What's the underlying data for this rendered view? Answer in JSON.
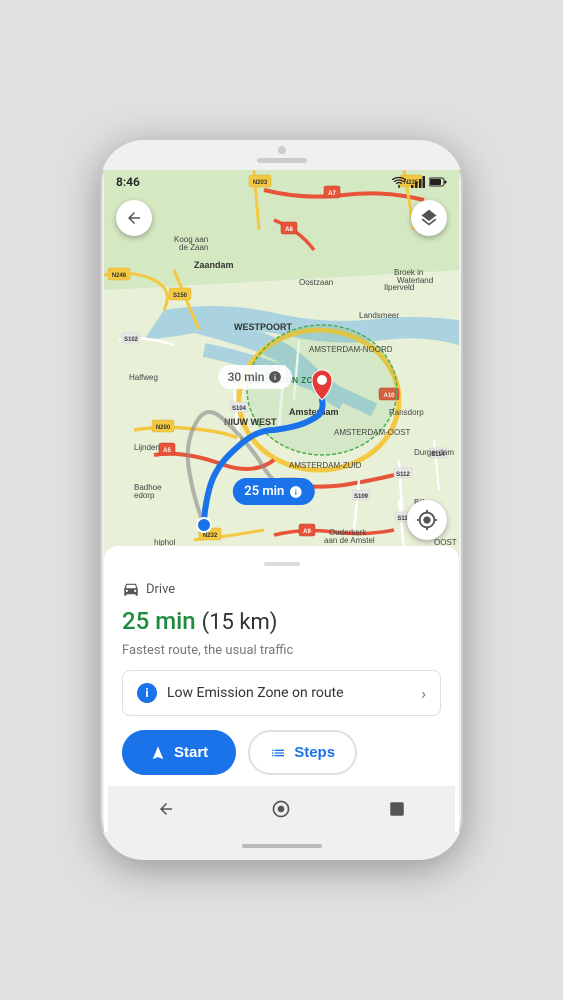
{
  "status_bar": {
    "time": "8:46"
  },
  "map": {
    "back_label": "←",
    "layers_label": "⬡",
    "location_label": "◎",
    "alt_route_time": "30 min",
    "main_route_time": "25 min"
  },
  "bottom_panel": {
    "handle": "",
    "transport_mode": "Drive",
    "duration": "25 min",
    "distance": "(15 km)",
    "subtitle": "Fastest route, the usual traffic",
    "lez_notice": "Low Emission Zone on route",
    "start_label": "Start",
    "steps_label": "Steps"
  },
  "nav_bar": {
    "back_label": "◀",
    "home_label": "●",
    "recent_label": "■"
  }
}
